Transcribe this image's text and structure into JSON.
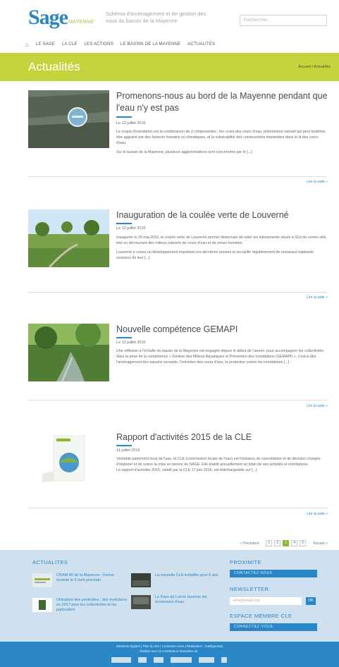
{
  "header": {
    "logo_sage": "Sage",
    "logo_mayenne": "MAYENNE",
    "tagline": "Schéma d'aménagement et de gestion des eaux du bassin de la Mayenne",
    "search_placeholder": "Rechercher..."
  },
  "nav": {
    "items": [
      "LE SAGE",
      "LA CLE",
      "LES ACTIONS",
      "LE BASSIN DE LA MAYENNE",
      "ACTUALITÉS"
    ]
  },
  "band": {
    "title": "Actualités",
    "breadcrumb": "Accueil / Actualités"
  },
  "articles": [
    {
      "title": "Promenons-nous au bord de la Mayenne pendant que l'eau n'y est pas",
      "date": "Le 12 juillet 2016",
      "paragraphs": [
        "Le risque d'inondation est la combinaison de 2 composantes : les crues des cours d'eau, phénomène naturel qui peut toutefois être aggravé par des facteurs humains ou climatiques, et la vulnérabilité des constructions implantées dans le lit des cours d'eau.",
        "Sur le bassin de la Mayenne, plusieurs agglomérations sont concernées par le [...]"
      ],
      "more": "Lire la suite »"
    },
    {
      "title": "Inauguration de la coulée verte de Louverné",
      "date": "Le 12 juillet 2016",
      "paragraphs": [
        "Inaugurée le 29 mai 2016, la coulée verte de Louverné permet désormais de relier les lotissements situés à l'Est du centre-ville, tout en découvrant des milieux naturels de cours d'eau et de zones humides.",
        "Louverné a connu un développement important ces dernières années et accueille régulièrement de nouveaux habitants soucieux de leur [...]"
      ],
      "more": "Lire la suite »"
    },
    {
      "title": "Nouvelle compétence GEMAPI",
      "date": "Le 12 juillet 2016",
      "paragraphs": [
        "Une réflexion à l'échelle du bassin de la Mayenne est engagée depuis le début de l'année, pour accompagner les collectivités dans la prise de la compétence « Gestion des Milieux Aquatiques et Prévention des Inondations (GEMAPI) », c'est-à-dire l'aménagement des bassins versants, l'entretien des cours d'eau, la protection contre les inondations [...]"
      ],
      "more": "Lire la suite »"
    },
    {
      "title": "Rapport d'activités 2015 de la CLE",
      "date": "11 juillet 2016",
      "paragraphs": [
        "Véritable parlement local de l'eau, la CLE (commission locale de l'eau) est l'instance de concertation et de décision chargée d'élaborer et de suivre la mise en œuvre du SAGE. Elle établit annuellement un bilan de ses activités et orientations.",
        "Le rapport d'activités 2015, validé par la CLE 17 juin 2016, est téléchargeable sur [...]"
      ],
      "more": "Lire la suite »"
    }
  ],
  "pager": {
    "prev": "« Précédent",
    "pages": [
      "1",
      "2",
      "3",
      "4",
      "5"
    ],
    "active_index": 2,
    "next": "Suivant »"
  },
  "footer": {
    "news_heading": "ACTUALITES",
    "news": [
      "CRAM 40 de la Mayenne : Ferme ouverte le 3 avril prochain",
      "La nouvelle CLE installée pour 6 ans",
      "Utilisation des pesticides : des évolutions en 2017 pour les collectivités et les particuliers",
      "Le Pays de Loiron favorise les économies d'eau"
    ],
    "proximite_heading": "PROXIMITE",
    "contact_button": "CONTACTEZ-NOUS",
    "newsletter_heading": "NEWSLETTER",
    "email_placeholder": "votre@email.com",
    "ok_label": "OK",
    "member_heading": "ESPACE MEMBRE CLE",
    "connect_button": "CONNECTEZ-VOUS",
    "bottom_links": "Mentions légales | Plan du site | Contactez-nous | Réalisation : Intelligentsia",
    "bottom_sub": "Réalisé avec la contribution financière de :"
  },
  "colors": {
    "brand_blue": "#2a86c7",
    "brand_green": "#c5d33c",
    "footer_bg": "#cfe0ee"
  }
}
